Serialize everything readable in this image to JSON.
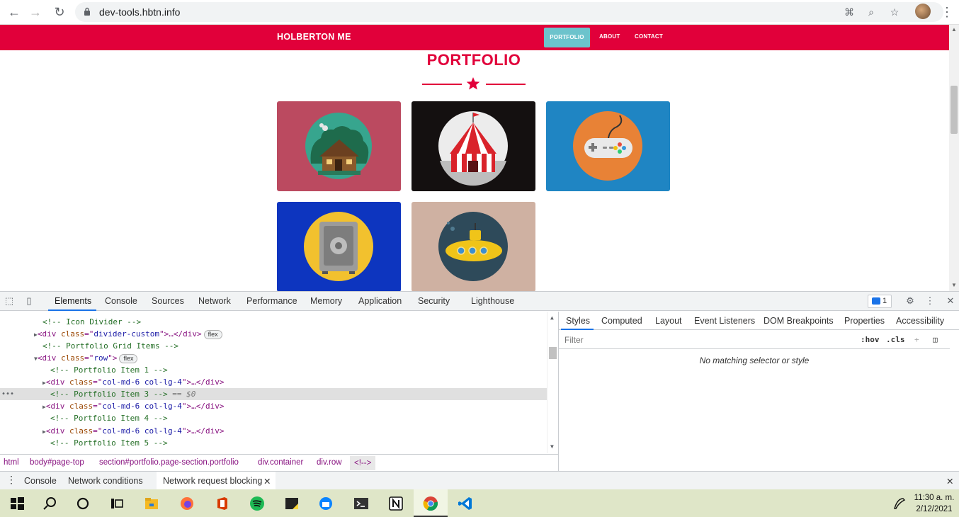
{
  "browser": {
    "url": "dev-tools.hbtn.info",
    "icons": [
      "back-icon",
      "forward-icon",
      "reload-icon",
      "lock-icon",
      "translate-icon",
      "zoom-icon",
      "star-icon",
      "avatar",
      "menu-icon"
    ]
  },
  "site": {
    "brand": "HOLBERTON ME",
    "nav": [
      "PORTFOLIO",
      "ABOUT",
      "CONTACT"
    ],
    "active_nav": "PORTFOLIO",
    "section_title": "PORTFOLIO",
    "portfolio_items": [
      {
        "icon": "cabin-icon",
        "bg": "#c2495f"
      },
      {
        "icon": "circus-tent-icon",
        "bg": "#141010"
      },
      {
        "icon": "game-controller-icon",
        "bg": "#1f85c3"
      },
      {
        "icon": "safe-icon",
        "bg": "#0d35bf"
      },
      {
        "icon": "submarine-icon",
        "bg": "#cfb1a2"
      }
    ],
    "colors": {
      "primary": "#e1003a",
      "accent": "#6cc3cc"
    }
  },
  "devtools": {
    "tabs": [
      "Elements",
      "Console",
      "Sources",
      "Network",
      "Performance",
      "Memory",
      "Application",
      "Security",
      "Lighthouse"
    ],
    "active_tab": "Elements",
    "issues_count": "1",
    "elements": {
      "lines": [
        {
          "indent": 4,
          "text": "<!-- Icon Divider -->",
          "kind": "comment"
        },
        {
          "indent": 3,
          "tag": "div",
          "attr": "class",
          "val": "divider-custom",
          "tail": ">…</div>",
          "badge": "flex",
          "collapsed": true
        },
        {
          "indent": 4,
          "text": "<!-- Portfolio Grid Items -->",
          "kind": "comment"
        },
        {
          "indent": 3,
          "tag": "div",
          "attr": "class",
          "val": "row",
          "tail": ">",
          "badge": "flex",
          "expanded": true
        },
        {
          "indent": 5,
          "text": "<!-- Portfolio Item 1 -->",
          "kind": "comment"
        },
        {
          "indent": 4,
          "tag": "div",
          "attr": "class",
          "val": "col-md-6 col-lg-4",
          "tail": ">…</div>",
          "collapsed": true
        },
        {
          "indent": 5,
          "text": "<!-- Portfolio Item 3 -->",
          "kind": "comment",
          "selected": true,
          "suffix": " == $0"
        },
        {
          "indent": 4,
          "tag": "div",
          "attr": "class",
          "val": "col-md-6 col-lg-4",
          "tail": ">…</div>",
          "collapsed": true
        },
        {
          "indent": 5,
          "text": "<!-- Portfolio Item 4 -->",
          "kind": "comment"
        },
        {
          "indent": 4,
          "tag": "div",
          "attr": "class",
          "val": "col-md-6 col-lg-4",
          "tail": ">…</div>",
          "collapsed": true
        },
        {
          "indent": 5,
          "text": "<!-- Portfolio Item 5 -->",
          "kind": "comment"
        }
      ]
    },
    "breadcrumbs": [
      "html",
      "body#page-top",
      "section#portfolio.page-section.portfolio",
      "div.container",
      "div.row",
      "<!-->"
    ],
    "styles_tabs": [
      "Styles",
      "Computed",
      "Layout",
      "Event Listeners",
      "DOM Breakpoints",
      "Properties",
      "Accessibility"
    ],
    "styles_active": "Styles",
    "filter_placeholder": "Filter",
    "hov": ":hov",
    "cls": ".cls",
    "no_match": "No matching selector or style",
    "drawer_tabs": [
      "Console",
      "Network conditions",
      "Network request blocking"
    ],
    "drawer_active": "Network request blocking"
  },
  "taskbar": {
    "apps": [
      "windows-start-icon",
      "search-icon",
      "cortana-icon",
      "task-view-icon",
      "file-explorer-icon",
      "firefox-icon",
      "office-icon",
      "spotify-icon",
      "sticky-notes-icon",
      "thunderbird-icon",
      "terminal-icon",
      "notion-icon",
      "chrome-icon",
      "vscode-icon"
    ],
    "active_app": "chrome-icon",
    "time": "11:30 a. m.",
    "date": "2/12/2021"
  }
}
